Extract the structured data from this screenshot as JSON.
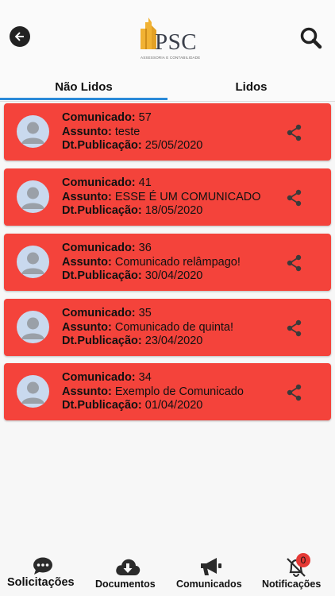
{
  "header": {
    "logo_text": "PSC",
    "logo_subtitle": "ASSESSORIA E CONTABILIDADE"
  },
  "tabs": [
    {
      "label": "Não Lidos",
      "active": true
    },
    {
      "label": "Lidos",
      "active": false
    }
  ],
  "labels": {
    "comunicado": "Comunicado:",
    "assunto": "Assunto:",
    "publicacao": "Dt.Publicação:"
  },
  "communications": [
    {
      "number": "57",
      "subject": "teste",
      "date": "25/05/2020"
    },
    {
      "number": "41",
      "subject": "ESSE É UM COMUNICADO",
      "date": "18/05/2020"
    },
    {
      "number": "36",
      "subject": "Comunicado relâmpago!",
      "date": "30/04/2020"
    },
    {
      "number": "35",
      "subject": "Comunicado de quinta!",
      "date": "23/04/2020"
    },
    {
      "number": "34",
      "subject": "Exemplo de Comunicado",
      "date": "01/04/2020"
    }
  ],
  "bottom_nav": [
    {
      "label": "Solicitações",
      "icon": "chat-bubble-icon"
    },
    {
      "label": "Documentos",
      "icon": "cloud-download-icon"
    },
    {
      "label": "Comunicados",
      "icon": "megaphone-icon"
    },
    {
      "label": "Notificações",
      "icon": "bell-off-icon"
    }
  ],
  "notification_badge": "0",
  "colors": {
    "card": "#f4433b",
    "accent": "#2a8ad8",
    "badge": "#e53935"
  }
}
